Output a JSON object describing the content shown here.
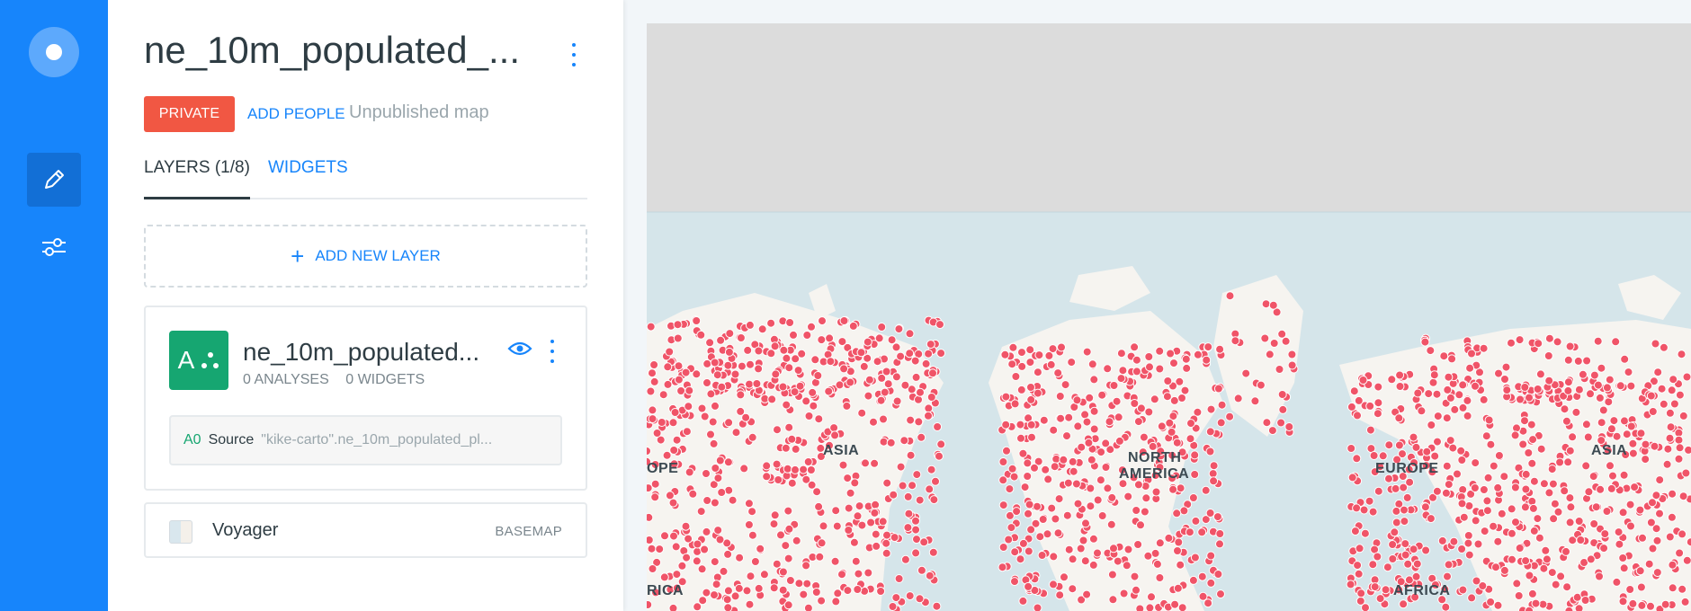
{
  "map_title": "ne_10m_populated_...",
  "privacy_badge": "PRIVATE",
  "add_people": "ADD PEOPLE",
  "publish_status": "Unpublished map",
  "tabs": [
    {
      "label": "LAYERS (1/8)",
      "active": true
    },
    {
      "label": "WIDGETS",
      "active": false
    }
  ],
  "add_layer_label": "ADD NEW LAYER",
  "layer": {
    "icon_letter": "A",
    "name": "ne_10m_populated...",
    "analyses": "0 ANALYSES",
    "widgets": "0 WIDGETS",
    "source_id": "A0",
    "source_label": "Source",
    "source_query": "\"kike-carto\".ne_10m_populated_pl...",
    "color": "#16a671"
  },
  "basemap": {
    "name": "Voyager",
    "tag": "BASEMAP"
  },
  "map": {
    "labels": [
      "OPE",
      "ASIA",
      "NORTH",
      "AMERICA",
      "EUROPE",
      "ASIA",
      "RICA",
      "AFRICA"
    ],
    "point_color": "#f05468",
    "ocean_color": "#d5e5ea",
    "land_color": "#f6f4f0"
  },
  "colors": {
    "accent": "#1785fb",
    "rail": "#1785fb",
    "badge": "#f15743"
  },
  "icons": {
    "logo": "carto-logo-icon",
    "edit": "pencil-icon",
    "settings": "sliders-icon",
    "menu": "kebab-menu-icon",
    "visibility": "eye-icon",
    "add": "plus-icon"
  }
}
